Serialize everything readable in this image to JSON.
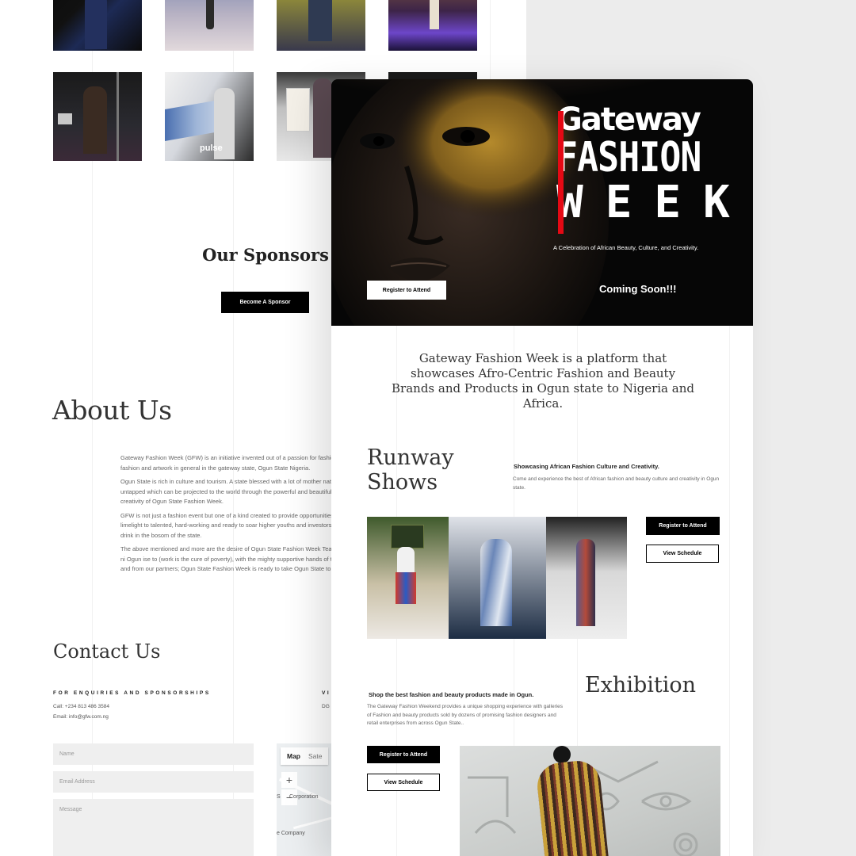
{
  "sponsors": {
    "heading": "Our Sponsors",
    "button": "Become A Sponsor"
  },
  "about": {
    "heading": "About Us",
    "paragraphs": [
      "Gateway Fashion Week (GFW) is an initiative invented out of a passion for fashion and the love of fashion and artwork in general in the gateway state, Ogun State Nigeria.",
      "Ogun State is rich in culture and tourism. A state blessed with a lot of mother nature's resources untapped which can be projected to the world through the powerful and beautiful fashion and creativity of Ogun State Fashion Week.",
      "GFW is not just a fashion event but one of a kind created to provide opportunities, exposure and limelight to talented, hard-working and ready to soar higher youths and investors who dwell and drink in the bosom of the state.",
      "The above mentioned and more are the desire of Ogun State Fashion Week Team. Ise loogun ise ni Ogun ise to (work is the cure of poverty), with the mighty supportive hands of the government and from our partners; Ogun State Fashion Week is ready to take Ogun State to the world."
    ]
  },
  "contact": {
    "heading": "Contact Us",
    "enquiries_label": "FOR ENQUIRIES AND SPONSORSHIPS",
    "phone": "Call: +234 813 486 3584",
    "email": "Email: info@gfw.com.ng",
    "visit_label": "VI",
    "visit_text": "DG",
    "form": {
      "name_placeholder": "Name",
      "email_placeholder": "Email Address",
      "message_placeholder": "Message"
    },
    "map": {
      "tab_map": "Map",
      "tab_satellite": "Sate",
      "zoom_in": "+",
      "zoom_out": "−",
      "label1": "Corporation",
      "label2": "e Company",
      "label3": "S"
    }
  },
  "hero": {
    "logo_word1": "Gateway",
    "logo_word2": "FASHION",
    "logo_word3": "WEEK",
    "tagline": "A Celebration of African Beauty, Culture, and Creativity.",
    "register_button": "Register to Attend",
    "coming_soon": "Coming Soon!!!"
  },
  "intro_text": "Gateway Fashion Week is a platform that showcases Afro-Centric Fashion and Beauty Brands and Products in Ogun state to Nigeria and Africa.",
  "runway": {
    "heading_line1": "Runway",
    "heading_line2": "Shows",
    "subheading": "Showcasing African Fashion Culture and Creativity.",
    "description": "Come and experience the best of African fashion and beauty culture and creativity in Ogun state.",
    "register_button": "Register to Attend",
    "schedule_button": "View Schedule"
  },
  "exhibition": {
    "heading": "Exhibition",
    "subheading": "Shop the best fashion and beauty products made in Ogun.",
    "description": "The Gateway Fashion Weekend provides a unique shopping experience with galleries of Fashion and beauty products sold by dozens of promising fashion designers and retail enterprises from across Ogun State..",
    "register_button": "Register to Attend",
    "schedule_button": "View Schedule"
  },
  "colors": {
    "accent": "#e50914",
    "black": "#000000",
    "paper": "#ffffff",
    "page_bg": "#ececec"
  }
}
